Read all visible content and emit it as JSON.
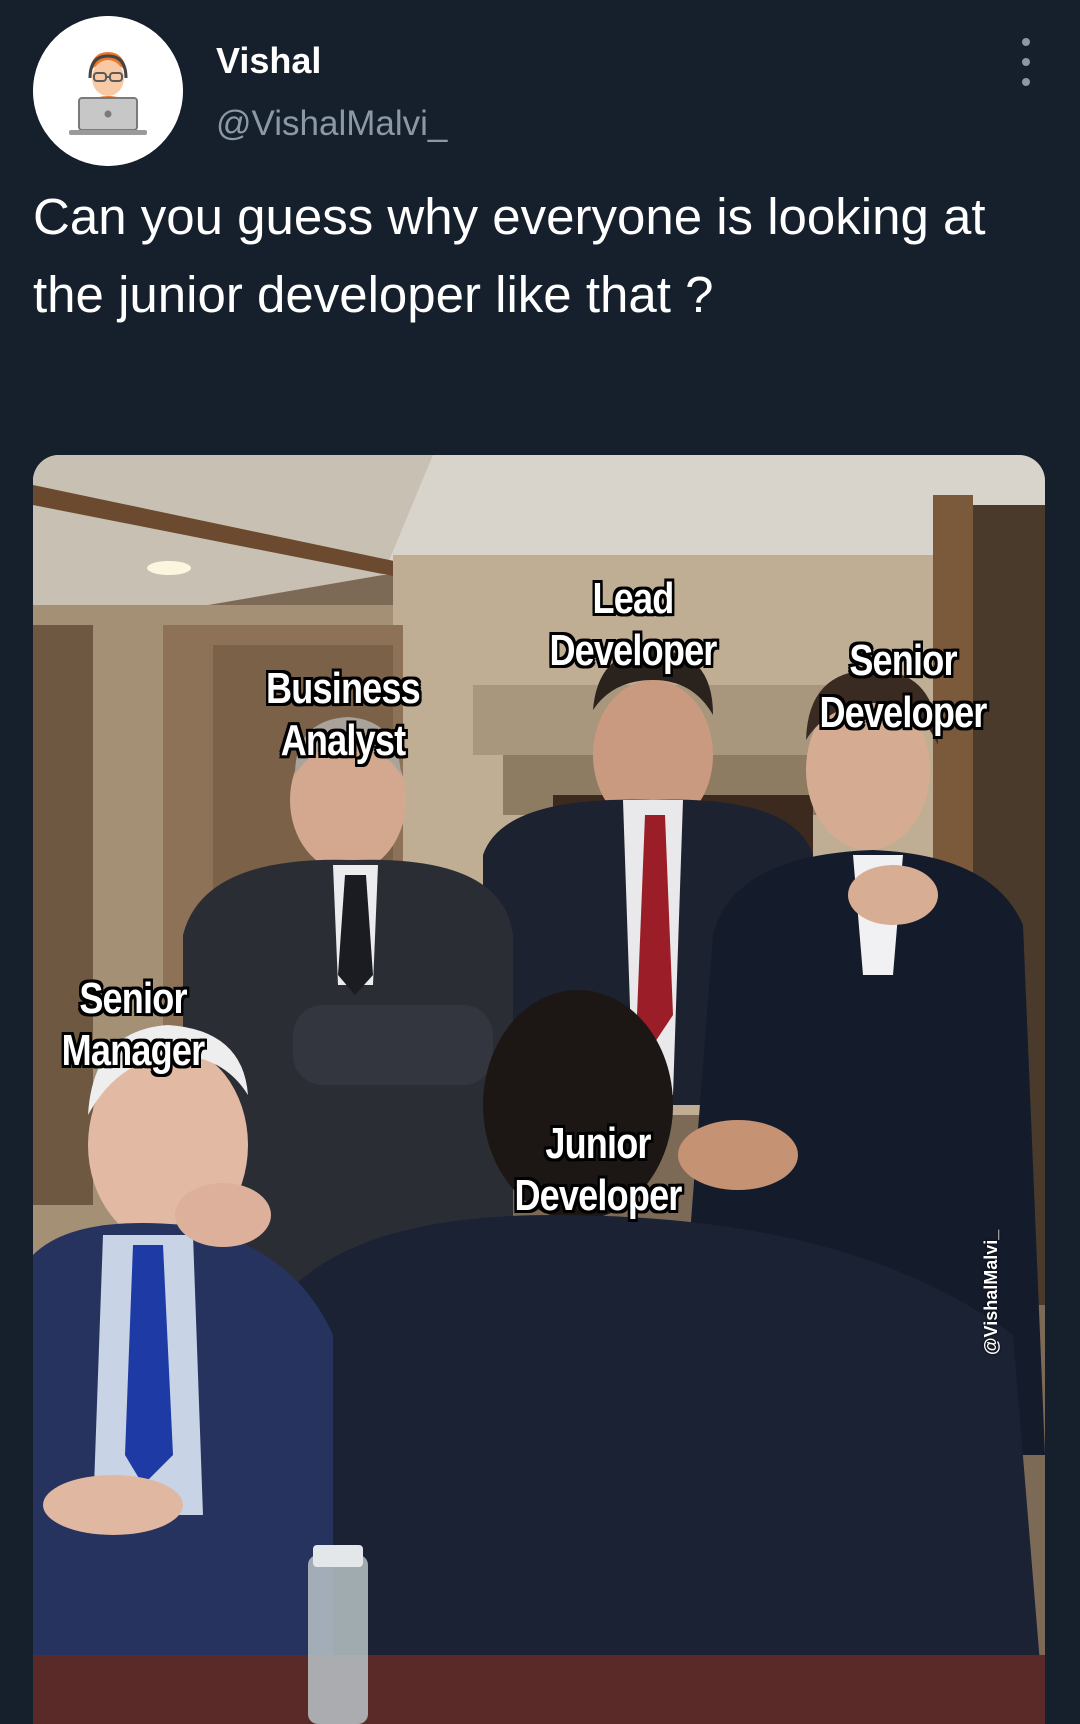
{
  "tweet": {
    "display_name": "Vishal",
    "handle": "@VishalMalvi_",
    "text": "Can you guess why everyone is looking at the junior developer like that ?",
    "avatar_icon": "developer-at-laptop-icon",
    "more_icon": "more-vertical-icon"
  },
  "media": {
    "labels": {
      "lead_developer": "Lead Developer",
      "senior_developer": "Senior Developer",
      "business_analyst": "Business Analyst",
      "senior_manager": "Senior Manager",
      "junior_developer": "Junior Developer"
    },
    "watermark": "@VishalMalvi_"
  },
  "colors": {
    "background": "#16202c",
    "text": "#ffffff",
    "secondary_text": "#8b98a5"
  }
}
